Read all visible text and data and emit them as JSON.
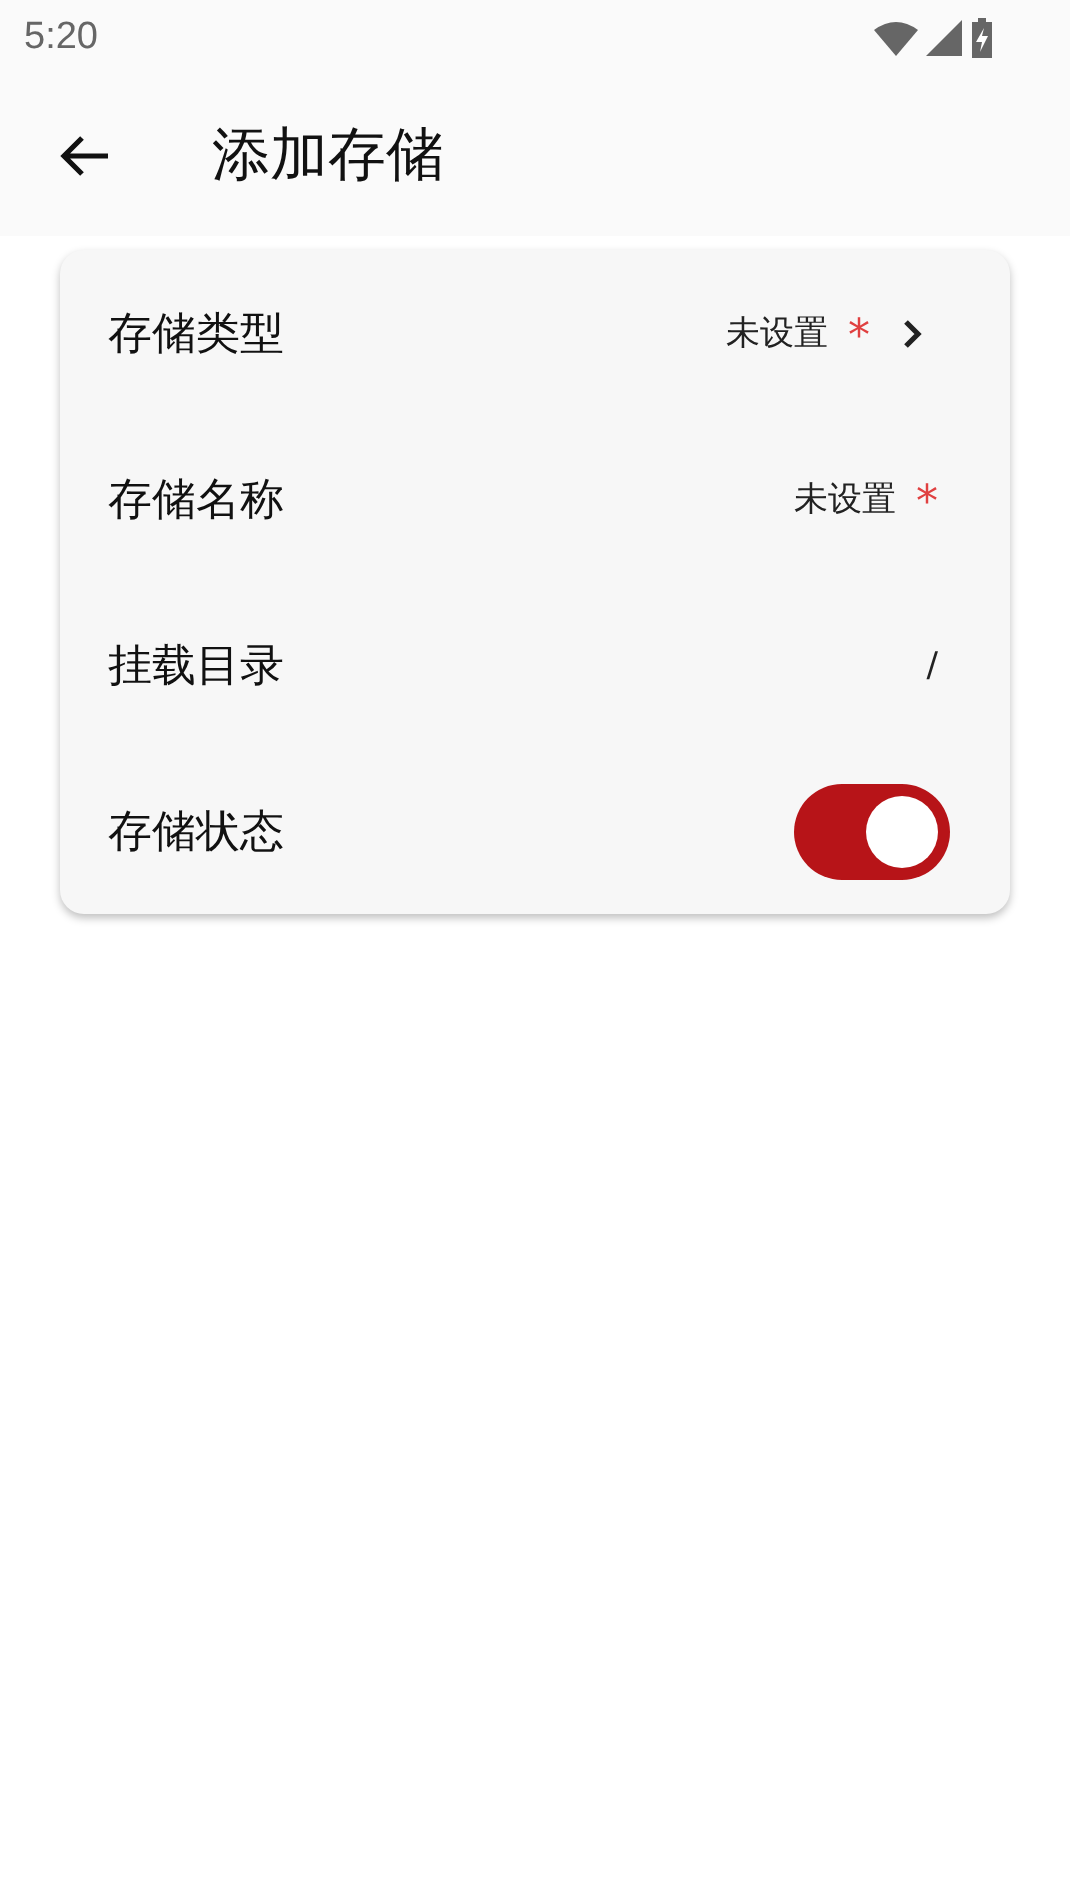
{
  "status_bar": {
    "time": "5:20"
  },
  "app_bar": {
    "title": "添加存储"
  },
  "rows": [
    {
      "kind": "select",
      "label": "存储类型",
      "value": "未设置",
      "required_mark": "*"
    },
    {
      "kind": "text",
      "label": "存储名称",
      "value": "未设置",
      "required_mark": "*"
    },
    {
      "kind": "text",
      "label": "挂载目录",
      "value": "/"
    },
    {
      "kind": "switch",
      "label": "存储状态",
      "on": true
    }
  ]
}
